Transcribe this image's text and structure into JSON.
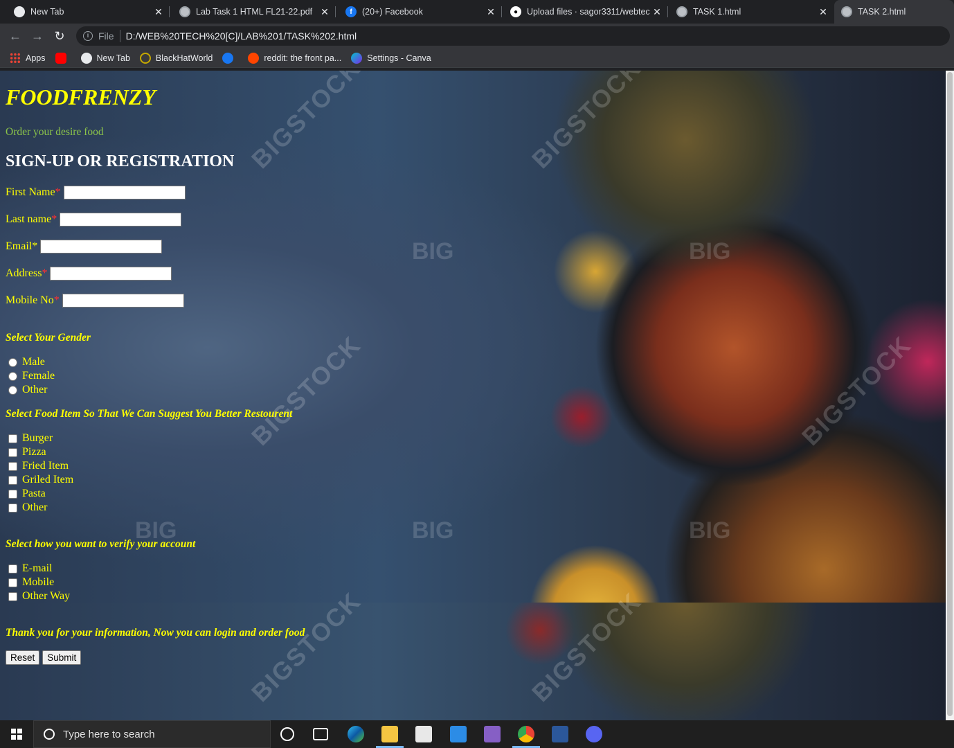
{
  "browser": {
    "tabs": [
      {
        "title": "New Tab",
        "icon": "chrome-icon",
        "active": false
      },
      {
        "title": "Lab Task 1 HTML FL21-22.pdf",
        "icon": "globe-icon",
        "active": false
      },
      {
        "title": "(20+) Facebook",
        "icon": "facebook-icon",
        "active": false
      },
      {
        "title": "Upload files · sagor3311/webtech",
        "icon": "github-icon",
        "active": false
      },
      {
        "title": "TASK 1.html",
        "icon": "globe-icon",
        "active": false
      },
      {
        "title": "TASK 2.html",
        "icon": "globe-icon",
        "active": true
      }
    ],
    "address": {
      "scheme": "File",
      "url": "D:/WEB%20TECH%20[C]/LAB%201/TASK%202.html"
    },
    "bookmarks": [
      {
        "label": "Apps",
        "icon": "apps-icon"
      },
      {
        "label": "",
        "icon": "youtube-icon"
      },
      {
        "label": "New Tab",
        "icon": "globe-icon"
      },
      {
        "label": "BlackHatWorld",
        "icon": "blackhatworld-icon"
      },
      {
        "label": "",
        "icon": "facebook-icon"
      },
      {
        "label": "reddit: the front pa...",
        "icon": "reddit-icon"
      },
      {
        "label": "Settings - Canva",
        "icon": "canva-icon"
      }
    ]
  },
  "page": {
    "site_title": "FOODFRENZY",
    "tagline": "Order your desire food",
    "heading": "SIGN-UP OR REGISTRATION",
    "fields": [
      {
        "label": "First Name",
        "required_mark": "*",
        "value": ""
      },
      {
        "label": "Last name",
        "required_mark": "*",
        "value": ""
      },
      {
        "label": "Email",
        "required_mark": "*",
        "value": ""
      },
      {
        "label": "Address",
        "required_mark": "*",
        "value": ""
      },
      {
        "label": "Mobile No",
        "required_mark": "*",
        "value": ""
      }
    ],
    "gender": {
      "title": "Select Your Gender",
      "options": [
        "Male",
        "Female",
        "Other"
      ]
    },
    "food": {
      "title": "Select Food Item So That We Can Suggest You Better Restourent",
      "options": [
        "Burger",
        "Pizza",
        "Fried Item",
        "Griled Item",
        "Pasta",
        "Other"
      ]
    },
    "verify": {
      "title": "Select how you want to verify your account",
      "options": [
        "E-mail",
        "Mobile",
        "Other Way"
      ]
    },
    "thanks": "Thank you for your information, Now you can login and order food",
    "buttons": {
      "reset": "Reset",
      "submit": "Submit"
    },
    "watermark": {
      "diag": "BIGSTOCK",
      "short": "BIG"
    }
  },
  "taskbar": {
    "search_placeholder": "Type here to search",
    "apps": [
      "cortana-icon",
      "task-view-icon",
      "edge-icon",
      "file-explorer-icon",
      "store-icon",
      "mail-icon",
      "visual-studio-icon",
      "chrome-icon",
      "word-icon",
      "discord-icon"
    ]
  },
  "colors": {
    "title": "#ffff00",
    "tagline": "#8bc34a",
    "heading": "#ffffff",
    "required": "#ff3030"
  }
}
